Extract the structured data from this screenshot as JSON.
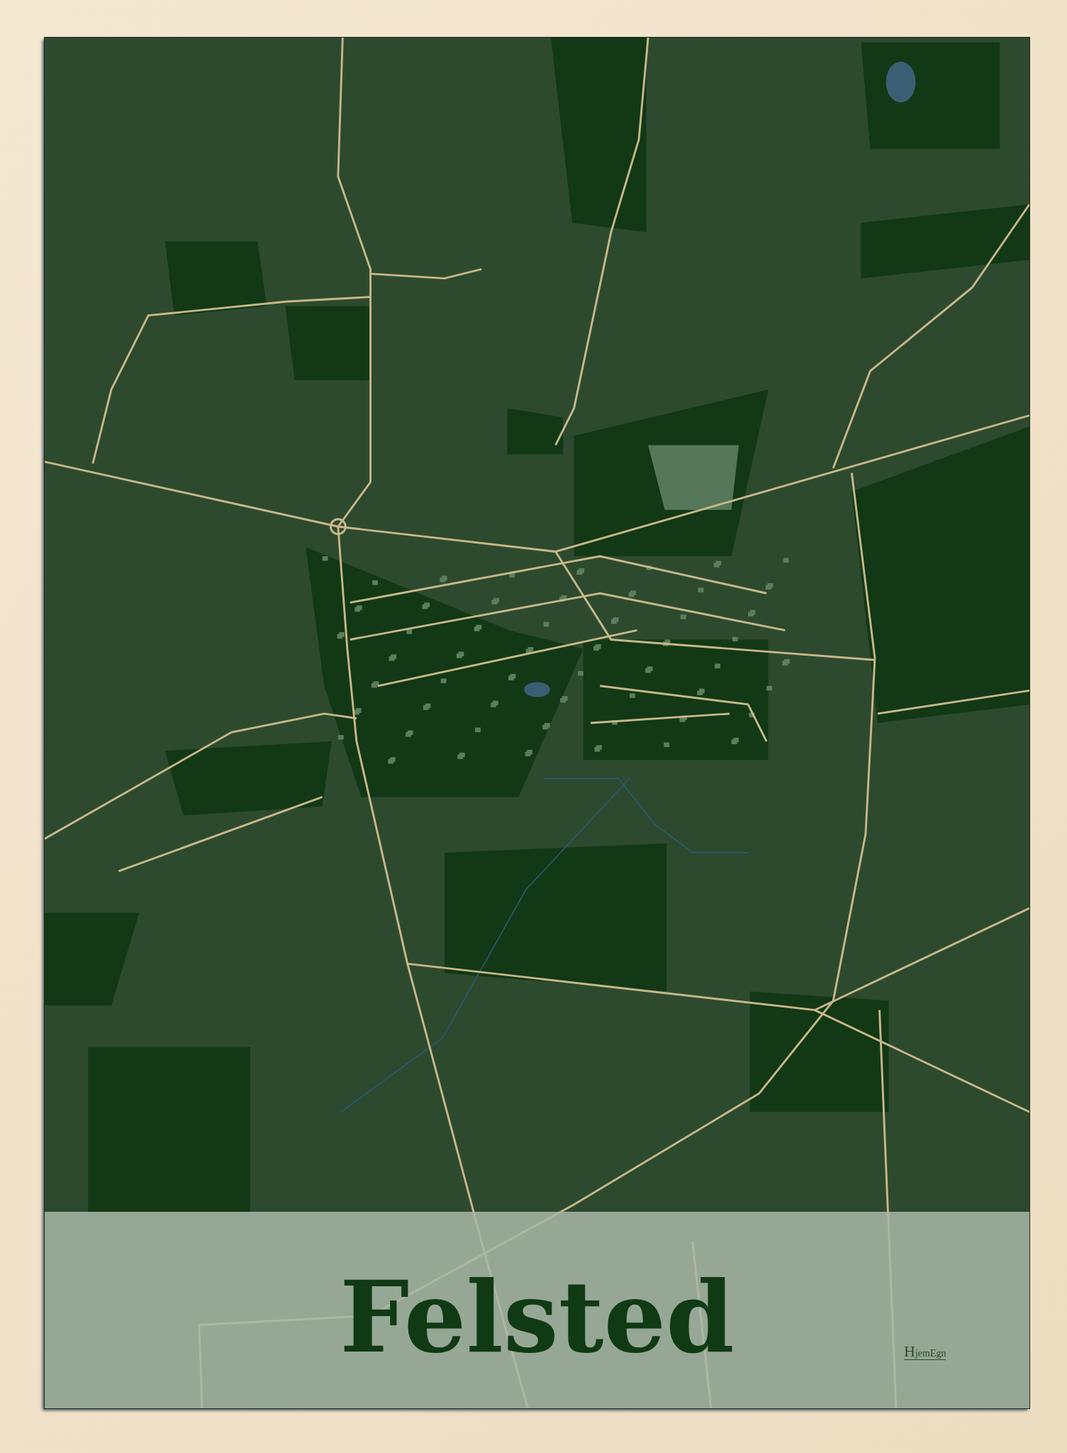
{
  "poster": {
    "title": "Felsted",
    "logo": "HjemEgn"
  }
}
